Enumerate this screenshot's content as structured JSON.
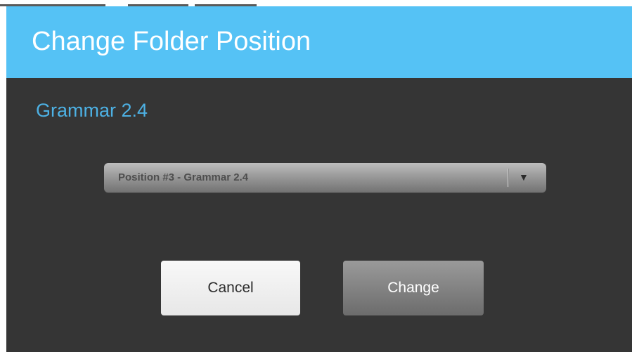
{
  "dialog": {
    "title": "Change Folder Position",
    "folder_name": "Grammar 2.4",
    "position_select": {
      "selected": "Position #3 - Grammar 2.4",
      "arrow_icon": "▼"
    },
    "buttons": {
      "cancel_label": "Cancel",
      "change_label": "Change"
    }
  },
  "colors": {
    "header": "#55c2f5",
    "body": "#353535",
    "folder_name": "#4db1e4"
  }
}
